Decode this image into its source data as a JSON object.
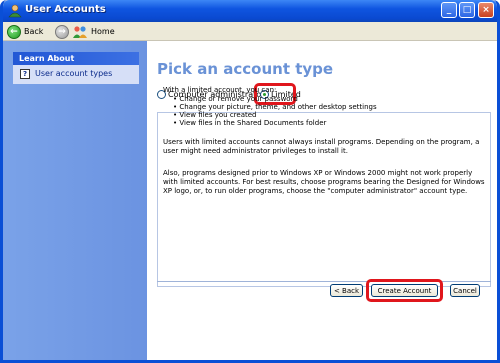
{
  "window": {
    "title": "User Accounts",
    "accent_color": "#0a4fd6",
    "highlight_color": "#e0161c"
  },
  "toolbar": {
    "back_label": "Back",
    "home_label": "Home"
  },
  "sidebar": {
    "panel_title": "Learn About",
    "items": [
      {
        "label": "User account types",
        "icon": "help-icon"
      }
    ]
  },
  "main": {
    "heading": "Pick an account type",
    "options": [
      {
        "label": "Computer administrator",
        "selected": false
      },
      {
        "label": "Limited",
        "selected": true
      }
    ],
    "intro": "With a limited account, you can:",
    "bullets": [
      "Change or remove your password",
      "Change your picture, theme, and other desktop settings",
      "View files you created",
      "View files in the Shared Documents folder"
    ],
    "para_one": "Users with limited accounts cannot always install programs. Depending on the program, a user might need administrator privileges to install it.",
    "para_two": "Also, programs designed prior to Windows XP or Windows 2000 might not work properly with limited accounts. For best results, choose programs bearing the Designed for Windows XP logo, or, to run older programs, choose the \"computer administrator\" account type.",
    "buttons": {
      "back": "< Back",
      "create": "Create Account",
      "cancel": "Cancel"
    }
  }
}
